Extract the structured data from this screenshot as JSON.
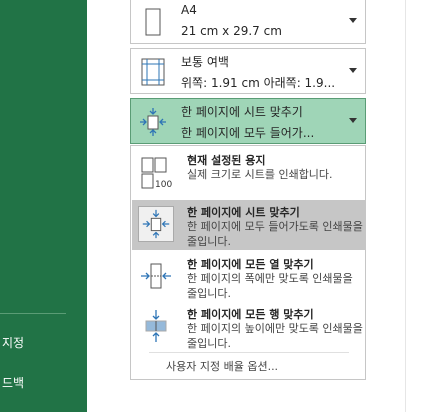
{
  "sidebar": {
    "items": [
      "지정",
      "드백"
    ]
  },
  "paper_size": {
    "name": "A4",
    "dimensions": "21 cm x 29.7 cm"
  },
  "margins": {
    "name": "보통 여백",
    "detail": "위쪽: 1.91 cm 아래쪽: 1.9..."
  },
  "scaling": {
    "name": "한 페이지에 시트 맞추기",
    "detail": "한 페이지에 모두 들어가..."
  },
  "menu": {
    "items": [
      {
        "title": "현재 설정된 용지",
        "desc": "실제 크기로 시트를 인쇄합니다.",
        "icon": "actual-size-icon"
      },
      {
        "title": "한 페이지에 시트 맞추기",
        "desc": "한 페이지에 모두 들어가도록 인쇄물을 줄입니다.",
        "icon": "fit-sheet-icon"
      },
      {
        "title": "한 페이지에 모든 열 맞추기",
        "desc": "한 페이지의 폭에만 맞도록 인쇄물을 줄입니다.",
        "icon": "fit-columns-icon"
      },
      {
        "title": "한 페이지에 모든 행 맞추기",
        "desc": "한 페이지의 높이에만 맞도록 인쇄물을 줄입니다.",
        "icon": "fit-rows-icon"
      }
    ],
    "custom": "사용자 지정 배율 옵션..."
  },
  "colors": {
    "sidebar": "#217346",
    "active": "#9fd5b7",
    "selected": "#c6c6c6",
    "arrow": "#2e75b6"
  }
}
